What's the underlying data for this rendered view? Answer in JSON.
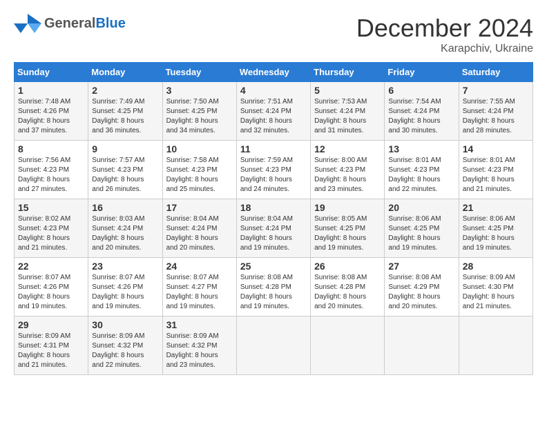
{
  "logo": {
    "general": "General",
    "blue": "Blue"
  },
  "title": "December 2024",
  "location": "Karapchiv, Ukraine",
  "days_of_week": [
    "Sunday",
    "Monday",
    "Tuesday",
    "Wednesday",
    "Thursday",
    "Friday",
    "Saturday"
  ],
  "weeks": [
    [
      {
        "day": "1",
        "sunrise": "7:48 AM",
        "sunset": "4:26 PM",
        "daylight": "8 hours and 37 minutes."
      },
      {
        "day": "2",
        "sunrise": "7:49 AM",
        "sunset": "4:25 PM",
        "daylight": "8 hours and 36 minutes."
      },
      {
        "day": "3",
        "sunrise": "7:50 AM",
        "sunset": "4:25 PM",
        "daylight": "8 hours and 34 minutes."
      },
      {
        "day": "4",
        "sunrise": "7:51 AM",
        "sunset": "4:24 PM",
        "daylight": "8 hours and 32 minutes."
      },
      {
        "day": "5",
        "sunrise": "7:53 AM",
        "sunset": "4:24 PM",
        "daylight": "8 hours and 31 minutes."
      },
      {
        "day": "6",
        "sunrise": "7:54 AM",
        "sunset": "4:24 PM",
        "daylight": "8 hours and 30 minutes."
      },
      {
        "day": "7",
        "sunrise": "7:55 AM",
        "sunset": "4:24 PM",
        "daylight": "8 hours and 28 minutes."
      }
    ],
    [
      {
        "day": "8",
        "sunrise": "7:56 AM",
        "sunset": "4:23 PM",
        "daylight": "8 hours and 27 minutes."
      },
      {
        "day": "9",
        "sunrise": "7:57 AM",
        "sunset": "4:23 PM",
        "daylight": "8 hours and 26 minutes."
      },
      {
        "day": "10",
        "sunrise": "7:58 AM",
        "sunset": "4:23 PM",
        "daylight": "8 hours and 25 minutes."
      },
      {
        "day": "11",
        "sunrise": "7:59 AM",
        "sunset": "4:23 PM",
        "daylight": "8 hours and 24 minutes."
      },
      {
        "day": "12",
        "sunrise": "8:00 AM",
        "sunset": "4:23 PM",
        "daylight": "8 hours and 23 minutes."
      },
      {
        "day": "13",
        "sunrise": "8:01 AM",
        "sunset": "4:23 PM",
        "daylight": "8 hours and 22 minutes."
      },
      {
        "day": "14",
        "sunrise": "8:01 AM",
        "sunset": "4:23 PM",
        "daylight": "8 hours and 21 minutes."
      }
    ],
    [
      {
        "day": "15",
        "sunrise": "8:02 AM",
        "sunset": "4:23 PM",
        "daylight": "8 hours and 21 minutes."
      },
      {
        "day": "16",
        "sunrise": "8:03 AM",
        "sunset": "4:24 PM",
        "daylight": "8 hours and 20 minutes."
      },
      {
        "day": "17",
        "sunrise": "8:04 AM",
        "sunset": "4:24 PM",
        "daylight": "8 hours and 20 minutes."
      },
      {
        "day": "18",
        "sunrise": "8:04 AM",
        "sunset": "4:24 PM",
        "daylight": "8 hours and 19 minutes."
      },
      {
        "day": "19",
        "sunrise": "8:05 AM",
        "sunset": "4:25 PM",
        "daylight": "8 hours and 19 minutes."
      },
      {
        "day": "20",
        "sunrise": "8:06 AM",
        "sunset": "4:25 PM",
        "daylight": "8 hours and 19 minutes."
      },
      {
        "day": "21",
        "sunrise": "8:06 AM",
        "sunset": "4:25 PM",
        "daylight": "8 hours and 19 minutes."
      }
    ],
    [
      {
        "day": "22",
        "sunrise": "8:07 AM",
        "sunset": "4:26 PM",
        "daylight": "8 hours and 19 minutes."
      },
      {
        "day": "23",
        "sunrise": "8:07 AM",
        "sunset": "4:26 PM",
        "daylight": "8 hours and 19 minutes."
      },
      {
        "day": "24",
        "sunrise": "8:07 AM",
        "sunset": "4:27 PM",
        "daylight": "8 hours and 19 minutes."
      },
      {
        "day": "25",
        "sunrise": "8:08 AM",
        "sunset": "4:28 PM",
        "daylight": "8 hours and 19 minutes."
      },
      {
        "day": "26",
        "sunrise": "8:08 AM",
        "sunset": "4:28 PM",
        "daylight": "8 hours and 20 minutes."
      },
      {
        "day": "27",
        "sunrise": "8:08 AM",
        "sunset": "4:29 PM",
        "daylight": "8 hours and 20 minutes."
      },
      {
        "day": "28",
        "sunrise": "8:09 AM",
        "sunset": "4:30 PM",
        "daylight": "8 hours and 21 minutes."
      }
    ],
    [
      {
        "day": "29",
        "sunrise": "8:09 AM",
        "sunset": "4:31 PM",
        "daylight": "8 hours and 21 minutes."
      },
      {
        "day": "30",
        "sunrise": "8:09 AM",
        "sunset": "4:32 PM",
        "daylight": "8 hours and 22 minutes."
      },
      {
        "day": "31",
        "sunrise": "8:09 AM",
        "sunset": "4:32 PM",
        "daylight": "8 hours and 23 minutes."
      },
      null,
      null,
      null,
      null
    ]
  ],
  "labels": {
    "sunrise": "Sunrise:",
    "sunset": "Sunset:",
    "daylight": "Daylight:"
  }
}
